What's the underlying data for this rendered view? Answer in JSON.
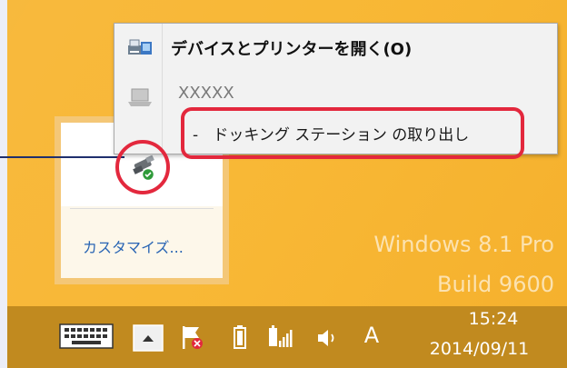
{
  "watermark": {
    "line1": "Windows 8.1 Pro",
    "line2": "Build 9600"
  },
  "tray_panel": {
    "customize_label": "カスタマイズ..."
  },
  "context_menu": {
    "open_devices_label": "デバイスとプリンターを開く(O)",
    "device_name": "XXXXX",
    "eject_dock_label": "-   ドッキング ステーション の取り出し"
  },
  "taskbar": {
    "input_indicator": "A",
    "time": "15:24",
    "date": "2014/09/11"
  },
  "colors": {
    "desktop": "#f7b531",
    "taskbar": "#c18a1f",
    "highlight": "#e3283d",
    "link": "#2a65b4"
  }
}
